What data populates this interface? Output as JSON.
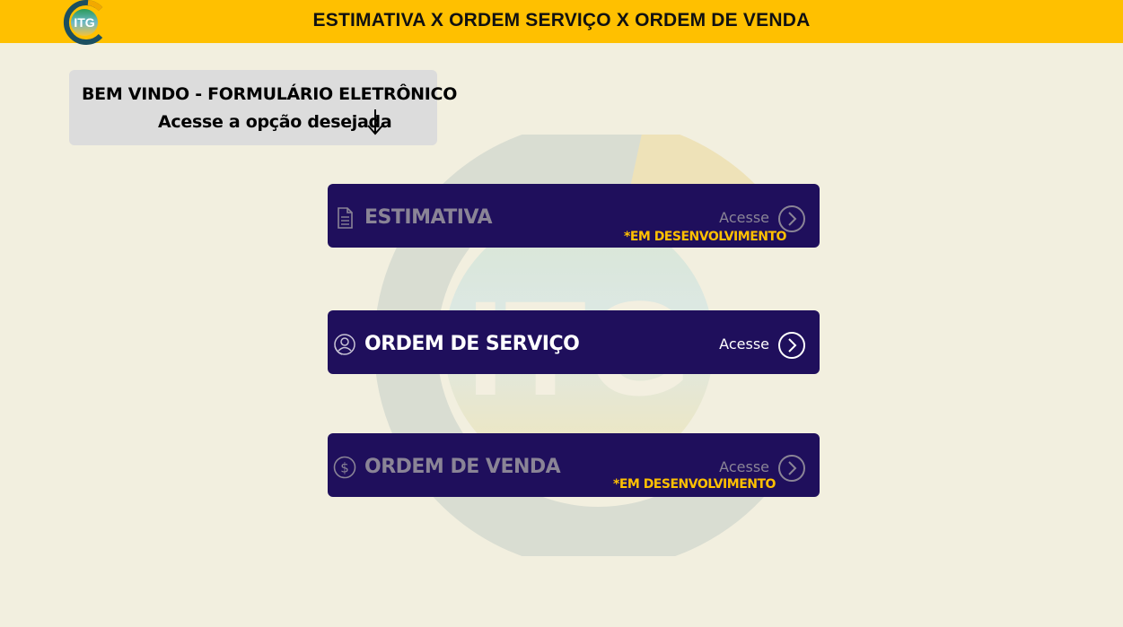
{
  "header": {
    "title": "ESTIMATIVA X ORDEM SERVIÇO X ORDEM DE VENDA",
    "logo_text": "ITG",
    "background_color": "#ffc000"
  },
  "welcome": {
    "title": "BEM VINDO - FORMULÁRIO ELETRÔNICO",
    "subtitle": "Acesse a opção desejada",
    "icon": "arrow-down-icon"
  },
  "watermark_text": "ITG",
  "cards": [
    {
      "label": "ESTIMATIVA",
      "access_label": "Acesse",
      "note": "*EM DESENVOLVIMENTO",
      "icon": "document-icon",
      "enabled": false
    },
    {
      "label": "ORDEM DE SERVIÇO",
      "access_label": "Acesse",
      "note": "",
      "icon": "service-person-icon",
      "enabled": true
    },
    {
      "label": "ORDEM DE VENDA",
      "access_label": "Acesse",
      "note": "*EM DESENVOLVIMENTO",
      "icon": "dollar-icon",
      "enabled": false
    }
  ],
  "colors": {
    "page_background": "#f2efdf",
    "card_background": "#1f0f5c",
    "accent": "#ffc000",
    "disabled_text": "#8a8496"
  }
}
